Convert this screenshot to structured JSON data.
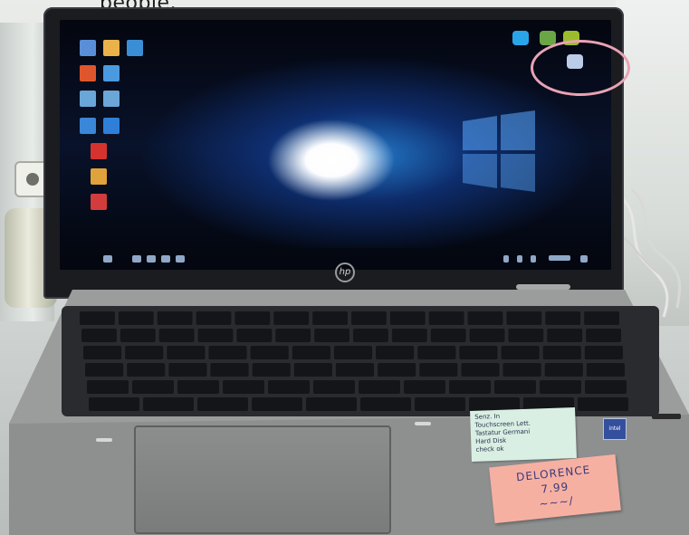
{
  "caption": {
    "top_text": "people."
  },
  "brand": {
    "logo_letters": "hp"
  },
  "screen": {
    "desktop_icons": [
      {
        "icon": "this-pc-icon",
        "color": "#5a8fd8"
      },
      {
        "icon": "folder-icon",
        "color": "#e9b34a"
      },
      {
        "icon": "network-icon",
        "color": "#3a8ed6"
      },
      {
        "icon": "office-icon",
        "color": "#e0562c"
      },
      {
        "icon": "app-icon",
        "color": "#4a9ae0"
      },
      {
        "icon": "app-icon",
        "color": "#6aa6d8"
      },
      {
        "icon": "app-icon",
        "color": "#6aa6d8"
      },
      {
        "icon": "ie-icon",
        "color": "#3a86d8"
      },
      {
        "icon": "edge-icon",
        "color": "#2f7fd8"
      },
      {
        "icon": "app-icon",
        "color": "#d6332e"
      },
      {
        "icon": "chrome-icon",
        "color": "#e0a23a"
      },
      {
        "icon": "app-icon",
        "color": "#d23c3c"
      }
    ],
    "top_right_icons": [
      {
        "icon": "skype-icon",
        "color": "#2aa4e8"
      },
      {
        "icon": "app-icon",
        "color": "#6aa646"
      },
      {
        "icon": "app-icon",
        "color": "#9bbd2b"
      },
      {
        "icon": "remote-desktop-icon",
        "color": "#b9cde8"
      }
    ],
    "highlight_color": "#e9a3b4",
    "wallpaper_accent": "#2a8ee6"
  },
  "notes": {
    "green": {
      "lines": [
        "Senz. In",
        "Touchscreen Lett.",
        "Tastatur Germani",
        "Hard Disk",
        "check ok"
      ]
    },
    "pink": {
      "lines": [
        "DELORENCE",
        "7.99",
        "~~~/"
      ]
    }
  },
  "badge": {
    "label": "intel"
  }
}
